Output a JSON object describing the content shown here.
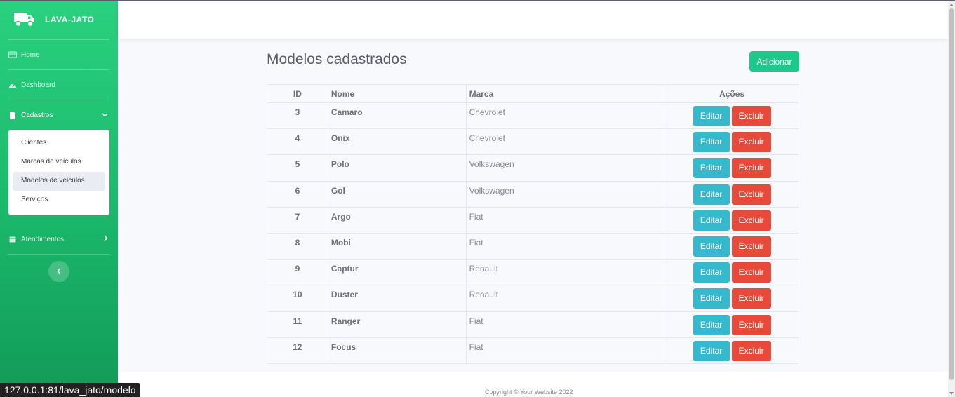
{
  "brand": {
    "name": "LAVA-JATO",
    "icon": "truck-icon"
  },
  "sidebar": {
    "items": [
      {
        "label": "Home",
        "icon": "home-icon"
      },
      {
        "label": "Dashboard",
        "icon": "tachometer-icon"
      },
      {
        "label": "Cadastros",
        "icon": "file-icon"
      },
      {
        "label": "Atendimentos",
        "icon": "calendar-icon"
      }
    ],
    "cadastros_sub": [
      {
        "label": "Clientes"
      },
      {
        "label": "Marcas de veiculos"
      },
      {
        "label": "Modelos de veiculos"
      },
      {
        "label": "Serviços"
      }
    ],
    "active_sub": "Modelos de veiculos",
    "toggle_icon": "chevron-left-icon"
  },
  "main": {
    "title": "Modelos cadastrados",
    "add_label": "Adicionar",
    "table": {
      "headers": [
        "ID",
        "Nome",
        "Marca",
        "Ações"
      ],
      "rows": [
        {
          "id": "3",
          "nome": "Camaro",
          "marca": "Chevrolet"
        },
        {
          "id": "4",
          "nome": "Onix",
          "marca": "Chevrolet"
        },
        {
          "id": "5",
          "nome": "Polo",
          "marca": "Volkswagen"
        },
        {
          "id": "6",
          "nome": "Gol",
          "marca": "Volkswagen"
        },
        {
          "id": "7",
          "nome": "Argo",
          "marca": "Fiat"
        },
        {
          "id": "8",
          "nome": "Mobi",
          "marca": "Fiat"
        },
        {
          "id": "9",
          "nome": "Captur",
          "marca": "Renault"
        },
        {
          "id": "10",
          "nome": "Duster",
          "marca": "Renault"
        },
        {
          "id": "11",
          "nome": "Ranger",
          "marca": "Fiat"
        },
        {
          "id": "12",
          "nome": "Focus",
          "marca": "Fiat"
        }
      ],
      "edit_label": "Editar",
      "delete_label": "Excluir"
    }
  },
  "footer": {
    "copyright": "Copyright © Your Website 2022"
  },
  "statusbar": {
    "url": "127.0.0.1:81/lava_jato/modelo"
  },
  "colors": {
    "sidebar": "#1cc88a",
    "primary_btn": "#1cc88a",
    "edit": "#36b9cc",
    "delete": "#e74a3b"
  }
}
